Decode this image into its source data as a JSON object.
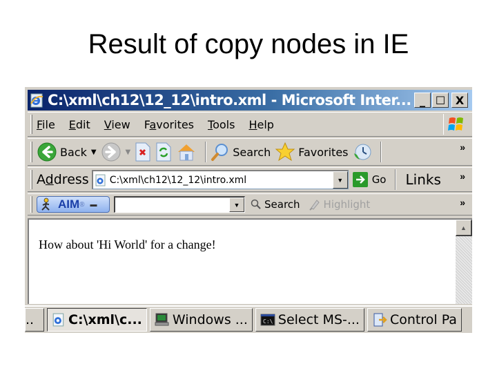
{
  "slide": {
    "title": "Result of copy nodes in IE"
  },
  "window": {
    "title": "C:\\xml\\ch12\\12_12\\intro.xml - Microsoft Inter...",
    "controls": {
      "minimize": "_",
      "maximize": "☐",
      "close": "X"
    }
  },
  "menu": {
    "items": [
      {
        "label": "File",
        "accel": "F"
      },
      {
        "label": "Edit",
        "accel": "E"
      },
      {
        "label": "View",
        "accel": "V"
      },
      {
        "label": "Favorites",
        "accel": "a"
      },
      {
        "label": "Tools",
        "accel": "T"
      },
      {
        "label": "Help",
        "accel": "H"
      }
    ],
    "logo_icon": "windows-flag-icon"
  },
  "toolbar": {
    "back_label": "Back",
    "search_label": "Search",
    "favorites_label": "Favorites",
    "overflow": "»",
    "icons": [
      "back-arrow-icon",
      "forward-arrow-icon",
      "stop-icon",
      "refresh-icon",
      "home-icon",
      "search-icon",
      "favorites-star-icon",
      "history-icon"
    ]
  },
  "address": {
    "label": "Address",
    "value": "C:\\xml\\ch12\\12_12\\intro.xml",
    "go_label": "Go",
    "links_label": "Links",
    "overflow": "»"
  },
  "aim": {
    "label": "AIM",
    "reg": "®",
    "input_value": "",
    "search_label": "Search",
    "highlight_label": "Highlight",
    "overflow": "»"
  },
  "content": {
    "text": "How about 'Hi World' for a change!"
  },
  "taskbar": {
    "partial_label": "..",
    "items": [
      {
        "label": "C:\\xml\\c...",
        "icon": "ie-page-icon",
        "active": true
      },
      {
        "label": "Windows ...",
        "icon": "computer-icon",
        "active": false
      },
      {
        "label": "Select MS-...",
        "icon": "command-prompt-icon",
        "active": false
      },
      {
        "label": "Control Pa",
        "icon": "control-panel-icon",
        "active": false
      }
    ]
  },
  "colors": {
    "titlebar_start": "#0a246a",
    "titlebar_end": "#a6caf0",
    "chrome": "#d4d0c8"
  }
}
